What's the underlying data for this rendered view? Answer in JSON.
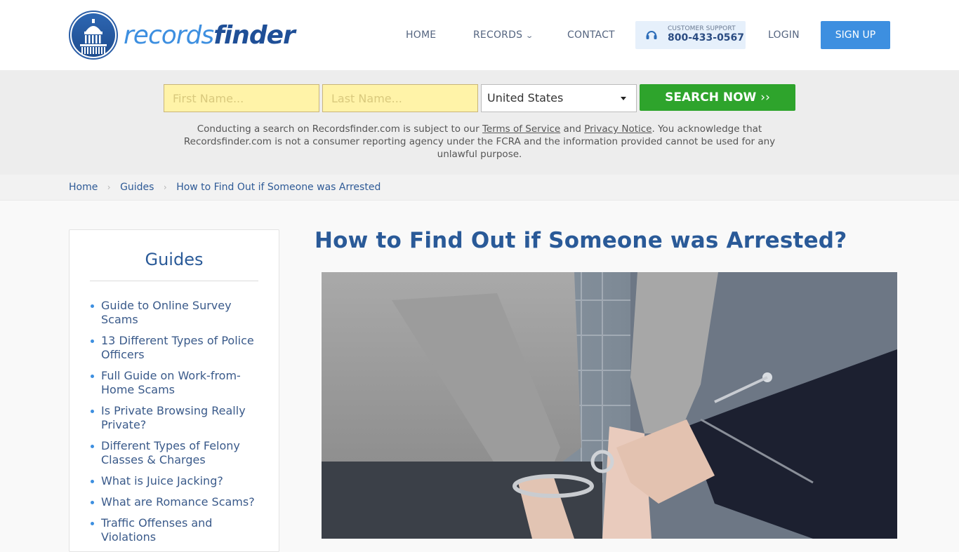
{
  "header": {
    "logo": {
      "part1": "records",
      "part2": "finder",
      "icon": "capitol-seal-icon"
    },
    "nav": {
      "home": "HOME",
      "records": "RECORDS",
      "contact": "CONTACT",
      "support_label": "CUSTOMER SUPPORT",
      "support_phone": "800-433-0567",
      "login": "LOGIN",
      "signup": "SIGN UP"
    }
  },
  "search": {
    "first_name_placeholder": "First Name...",
    "last_name_placeholder": "Last Name...",
    "state_selected": "United States",
    "button_label": "SEARCH NOW",
    "button_arrow": "››",
    "disclaimer_pre": "Conducting a search on Recordsfinder.com is subject to our ",
    "terms_link": "Terms of Service",
    "disclaimer_and": " and ",
    "privacy_link": "Privacy Notice",
    "disclaimer_post": ". You acknowledge that Recordsfinder.com is not a consumer reporting agency under the FCRA and the information provided cannot be used for any unlawful purpose."
  },
  "breadcrumb": {
    "items": [
      "Home",
      "Guides",
      "How to Find Out if Someone was Arrested"
    ],
    "separator": "›"
  },
  "sidebar": {
    "title": "Guides",
    "items": [
      "Guide to Online Survey Scams",
      "13 Different Types of Police Officers",
      "Full Guide on Work-from-Home Scams",
      "Is Private Browsing Really Private?",
      "Different Types of Felony Classes & Charges",
      "What is Juice Jacking?",
      "What are Romance Scams?",
      "Traffic Offenses and Violations"
    ]
  },
  "main": {
    "title": "How to Find Out if Someone was Arrested?",
    "hero_image": "person-being-handcuffed-photo"
  },
  "colors": {
    "brand_blue": "#3d8fe0",
    "brand_dark": "#1f4f97",
    "search_green": "#2ea42c",
    "input_yellow": "#fff3a8"
  }
}
